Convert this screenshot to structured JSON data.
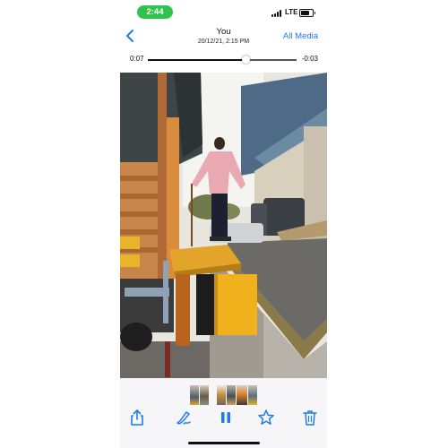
{
  "status_bar": {
    "time": "2:44",
    "network": "LTE",
    "signal_icon": "cellular-signal-icon",
    "battery_icon": "battery-icon",
    "time_pill_color": "#2fc24e"
  },
  "nav": {
    "back_icon": "chevron-left-icon",
    "title": "You",
    "subtitle": "20/12/21, 2:15 PM",
    "all_media_label": "All Media",
    "accent_color": "#1f7be6"
  },
  "player": {
    "elapsed": "0:07",
    "remaining": "-0:03",
    "progress": 0.7
  },
  "toolbar": {
    "share_icon": "share-icon",
    "markup_icon": "markup-pen-icon",
    "pause_icon": "pause-icon",
    "favorite_icon": "star-icon",
    "delete_icon": "trash-icon"
  }
}
